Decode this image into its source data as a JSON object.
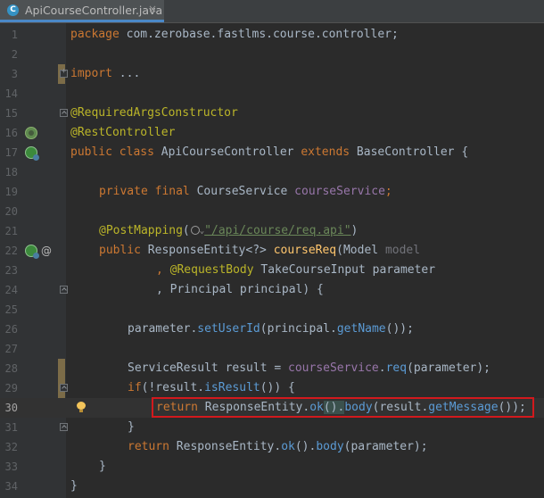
{
  "tab": {
    "icon_letter": "C",
    "title": "ApiCourseController.java",
    "close_glyph": "×"
  },
  "icons": {
    "gutter_bean": "spring-bean-icon",
    "gutter_web": "web-endpoint-icon",
    "gutter_annotation": "@",
    "intention": "lightbulb-icon",
    "fold_collapsed": "fold-plus-icon",
    "fold_expanded": "fold-minus-icon"
  },
  "lines": {
    "l1": {
      "n": "1",
      "pkg_kw": "package",
      "pkg_name": " com.zerobase.fastlms.course.controller;"
    },
    "l2": {
      "n": "2"
    },
    "l3": {
      "n": "3",
      "import_kw": "import",
      "import_rest": " ..."
    },
    "l14": {
      "n": "14"
    },
    "l15": {
      "n": "15",
      "ann": "@RequiredArgsConstructor"
    },
    "l16": {
      "n": "16",
      "ann": "@RestController"
    },
    "l17": {
      "n": "17",
      "kw1": "public",
      "kw2": "class",
      "name": " ApiCourseController ",
      "kw3": "extends",
      "rest": " BaseController {"
    },
    "l18": {
      "n": "18"
    },
    "l19": {
      "n": "19",
      "kw1": "private",
      "kw2": "final",
      "type": " CourseService ",
      "field": "courseService",
      "end": ";"
    },
    "l20": {
      "n": "20"
    },
    "l21": {
      "n": "21",
      "ann": "@PostMapping",
      "open": "(",
      "str": "\"/api/course/req.api\"",
      "close": ")"
    },
    "l22": {
      "n": "22",
      "kw1": "public",
      "type": " ResponseEntity<?> ",
      "method": "courseReq",
      "open": "(Model ",
      "param": "model"
    },
    "l23": {
      "n": "23",
      "comma": ", ",
      "ann": "@RequestBody",
      "type": " TakeCourseInput ",
      "param": "parameter"
    },
    "l24": {
      "n": "24",
      "comma": ", Principal ",
      "param": "principal",
      "end": ") {"
    },
    "l25": {
      "n": "25"
    },
    "l26": {
      "n": "26",
      "obj": "parameter",
      "dot": ".",
      "m1": "setUserId",
      "p1": "(",
      "arg": "principal",
      "dot2": ".",
      "m2": "getName",
      "end": "());"
    },
    "l27": {
      "n": "27"
    },
    "l28": {
      "n": "28",
      "type": "ServiceResult result = ",
      "field": "courseService",
      "dot": ".",
      "m": "req",
      "open": "(",
      "arg": "parameter",
      "end": ");"
    },
    "l29": {
      "n": "29",
      "kw": "if",
      "p": "(!result.",
      "m": "isResult",
      "end": "()) {"
    },
    "l30": {
      "n": "30",
      "kw": "return",
      "a": " ResponseEntity.",
      "m1": "ok",
      "b": "().",
      "m2": "body",
      "c": "(result.",
      "m3": "getMessage",
      "d": "());"
    },
    "l31": {
      "n": "31",
      "brace": "}"
    },
    "l32": {
      "n": "32",
      "kw": "return",
      "a": " ResponseEntity.",
      "m1": "ok",
      "b": "().",
      "m2": "body",
      "c": "(parameter);"
    },
    "l33": {
      "n": "33",
      "brace": "}"
    },
    "l34": {
      "n": "34",
      "brace": "}"
    }
  }
}
